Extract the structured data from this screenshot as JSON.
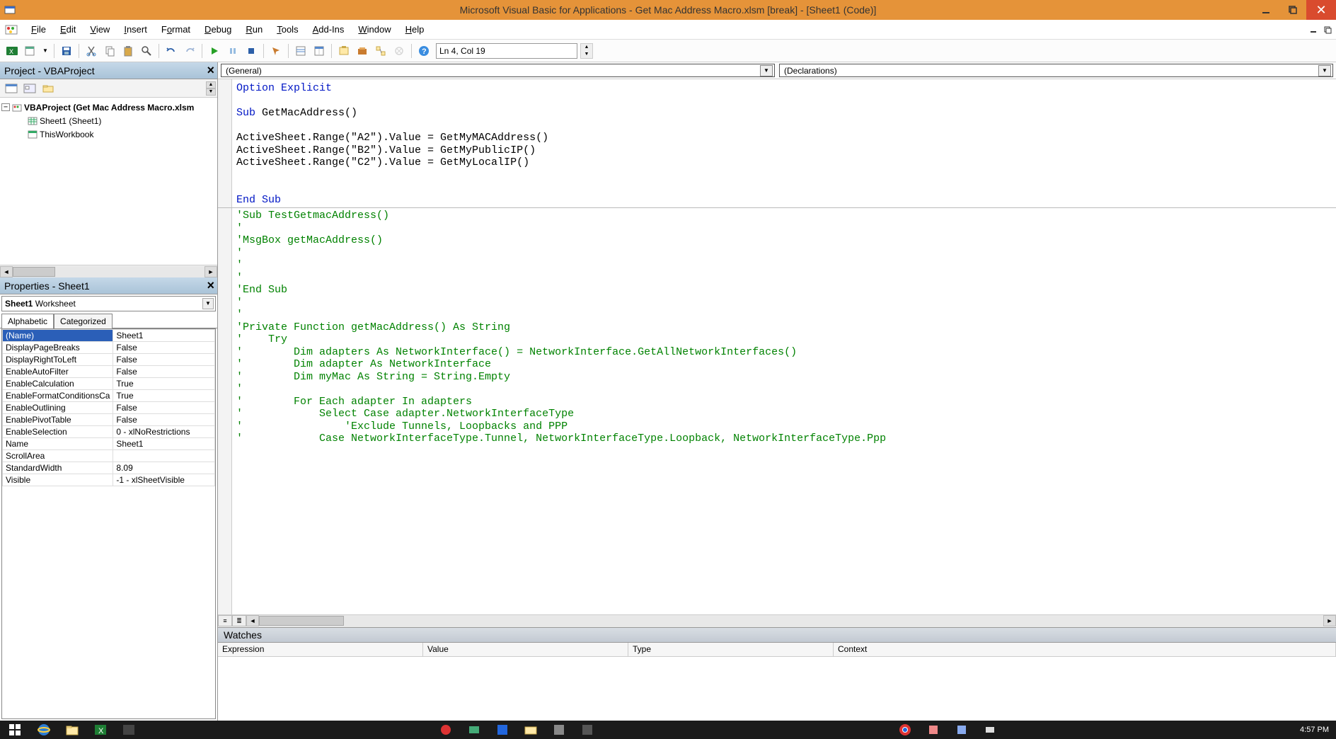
{
  "title": "Microsoft Visual Basic for Applications - Get Mac Address Macro.xlsm [break] - [Sheet1 (Code)]",
  "menu": [
    "File",
    "Edit",
    "View",
    "Insert",
    "Format",
    "Debug",
    "Run",
    "Tools",
    "Add-Ins",
    "Window",
    "Help"
  ],
  "cursor_pos": "Ln 4, Col 19",
  "project_panel_title": "Project - VBAProject",
  "project_root": "VBAProject (Get Mac Address Macro.xlsm",
  "project_items": [
    "Sheet1 (Sheet1)",
    "ThisWorkbook"
  ],
  "props_panel_title": "Properties - Sheet1",
  "props_combo": "Sheet1 Worksheet",
  "props_tabs": [
    "Alphabetic",
    "Categorized"
  ],
  "props": [
    {
      "n": "(Name)",
      "v": "Sheet1",
      "sel": true
    },
    {
      "n": "DisplayPageBreaks",
      "v": "False"
    },
    {
      "n": "DisplayRightToLeft",
      "v": "False"
    },
    {
      "n": "EnableAutoFilter",
      "v": "False"
    },
    {
      "n": "EnableCalculation",
      "v": "True"
    },
    {
      "n": "EnableFormatConditionsCa",
      "v": "True"
    },
    {
      "n": "EnableOutlining",
      "v": "False"
    },
    {
      "n": "EnablePivotTable",
      "v": "False"
    },
    {
      "n": "EnableSelection",
      "v": "0 - xlNoRestrictions"
    },
    {
      "n": "Name",
      "v": "Sheet1"
    },
    {
      "n": "ScrollArea",
      "v": ""
    },
    {
      "n": "StandardWidth",
      "v": "8.09"
    },
    {
      "n": "Visible",
      "v": "-1 - xlSheetVisible"
    }
  ],
  "code_combo_left": "(General)",
  "code_combo_right": "(Declarations)",
  "code_lines": [
    {
      "t": "kw",
      "s": "Option Explicit"
    },
    {
      "t": "",
      "s": ""
    },
    {
      "t": "mix",
      "parts": [
        [
          "kw",
          "Sub "
        ],
        [
          "tx",
          "GetMacAddress()"
        ]
      ]
    },
    {
      "t": "",
      "s": ""
    },
    {
      "t": "tx",
      "s": "ActiveSheet.Range(\"A2\").Value = GetMyMACAddress()"
    },
    {
      "t": "tx",
      "s": "ActiveSheet.Range(\"B2\").Value = GetMyPublicIP()"
    },
    {
      "t": "tx",
      "s": "ActiveSheet.Range(\"C2\").Value = GetMyLocalIP()"
    },
    {
      "t": "",
      "s": ""
    },
    {
      "t": "",
      "s": ""
    },
    {
      "t": "kw",
      "s": "End Sub"
    },
    {
      "t": "hr",
      "s": ""
    },
    {
      "t": "cm",
      "s": "'Sub TestGetmacAddress()"
    },
    {
      "t": "cm",
      "s": "'"
    },
    {
      "t": "cm",
      "s": "'MsgBox getMacAddress()"
    },
    {
      "t": "cm",
      "s": "'"
    },
    {
      "t": "cm",
      "s": "'"
    },
    {
      "t": "cm",
      "s": "'"
    },
    {
      "t": "cm",
      "s": "'End Sub"
    },
    {
      "t": "cm",
      "s": "'"
    },
    {
      "t": "cm",
      "s": "'"
    },
    {
      "t": "cm",
      "s": "'Private Function getMacAddress() As String"
    },
    {
      "t": "cm",
      "s": "'    Try"
    },
    {
      "t": "cm",
      "s": "'        Dim adapters As NetworkInterface() = NetworkInterface.GetAllNetworkInterfaces()"
    },
    {
      "t": "cm",
      "s": "'        Dim adapter As NetworkInterface"
    },
    {
      "t": "cm",
      "s": "'        Dim myMac As String = String.Empty"
    },
    {
      "t": "cm",
      "s": "'"
    },
    {
      "t": "cm",
      "s": "'        For Each adapter In adapters"
    },
    {
      "t": "cm",
      "s": "'            Select Case adapter.NetworkInterfaceType"
    },
    {
      "t": "cm",
      "s": "'                'Exclude Tunnels, Loopbacks and PPP"
    },
    {
      "t": "cm",
      "s": "'            Case NetworkInterfaceType.Tunnel, NetworkInterfaceType.Loopback, NetworkInterfaceType.Ppp"
    }
  ],
  "watches_title": "Watches",
  "watch_cols": [
    "Expression",
    "Value",
    "Type",
    "Context"
  ],
  "clock": "4:57 PM"
}
